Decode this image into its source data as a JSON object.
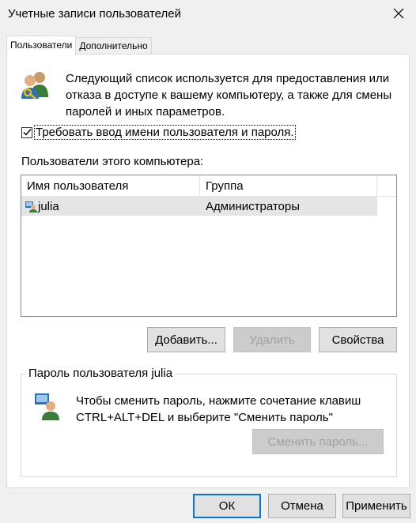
{
  "window": {
    "title": "Учетные записи пользователей"
  },
  "tabs": [
    {
      "label": "Пользователи",
      "active": true
    },
    {
      "label": "Дополнительно",
      "active": false
    }
  ],
  "intro": {
    "icon": "users-icon",
    "text": "Следующий список используется для предоставления или отказа в доступе к вашему компьютеру, а также для смены паролей и иных параметров."
  },
  "require_login": {
    "label": "Требовать ввод имени пользователя и пароля.",
    "checked": true
  },
  "users_list": {
    "label": "Пользователи этого компьютера:",
    "columns": [
      "Имя пользователя",
      "Группа"
    ],
    "rows": [
      {
        "name": "julia",
        "group": "Администраторы",
        "icon": "user-icon"
      }
    ]
  },
  "list_buttons": {
    "add": "Добавить...",
    "remove": "Удалить",
    "properties": "Свойства"
  },
  "password_group": {
    "title": "Пароль пользователя julia",
    "icon": "user-key-icon",
    "text": "Чтобы сменить пароль, нажмите сочетание клавиш CTRL+ALT+DEL и выберите \"Сменить пароль\"",
    "button": "Сменить пароль..."
  },
  "dialog_buttons": {
    "ok": "ОК",
    "cancel": "Отмена",
    "apply": "Применить"
  },
  "colors": {
    "window_bg": "#f0f0f0",
    "panel_bg": "#ffffff",
    "focus_border": "#0078d7",
    "disabled_text": "#a0a0a0"
  }
}
